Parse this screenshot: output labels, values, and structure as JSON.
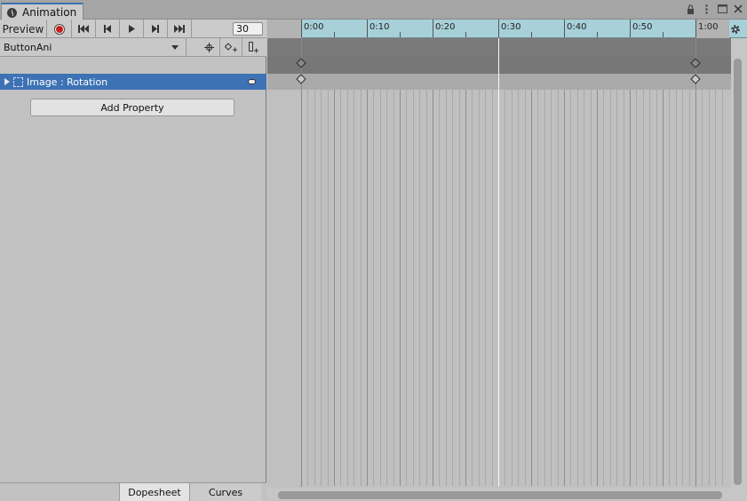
{
  "window": {
    "tab_label": "Animation",
    "tab_icon": "clock-icon",
    "controls": [
      "lock-icon",
      "menu-icon",
      "maximize-icon",
      "close-icon"
    ]
  },
  "toolbar": {
    "preview_label": "Preview",
    "frame_value": "30"
  },
  "clip": {
    "name": "ButtonAni"
  },
  "properties": [
    {
      "label": "Image : Rotation"
    }
  ],
  "add_property_label": "Add Property",
  "bottom_tabs": {
    "dopesheet": "Dopesheet",
    "curves": "Curves",
    "active": "Dopesheet"
  },
  "timeline": {
    "tick_labels": [
      "0:00",
      "0:10",
      "0:20",
      "0:30",
      "0:40",
      "0:50",
      "1:00"
    ],
    "playhead_frame": 30,
    "keyframe_frames": [
      0,
      60
    ]
  },
  "colors": {
    "accent_selection": "#3d73b5",
    "record": "#c8201a",
    "ruler": "#a8d0d8"
  }
}
